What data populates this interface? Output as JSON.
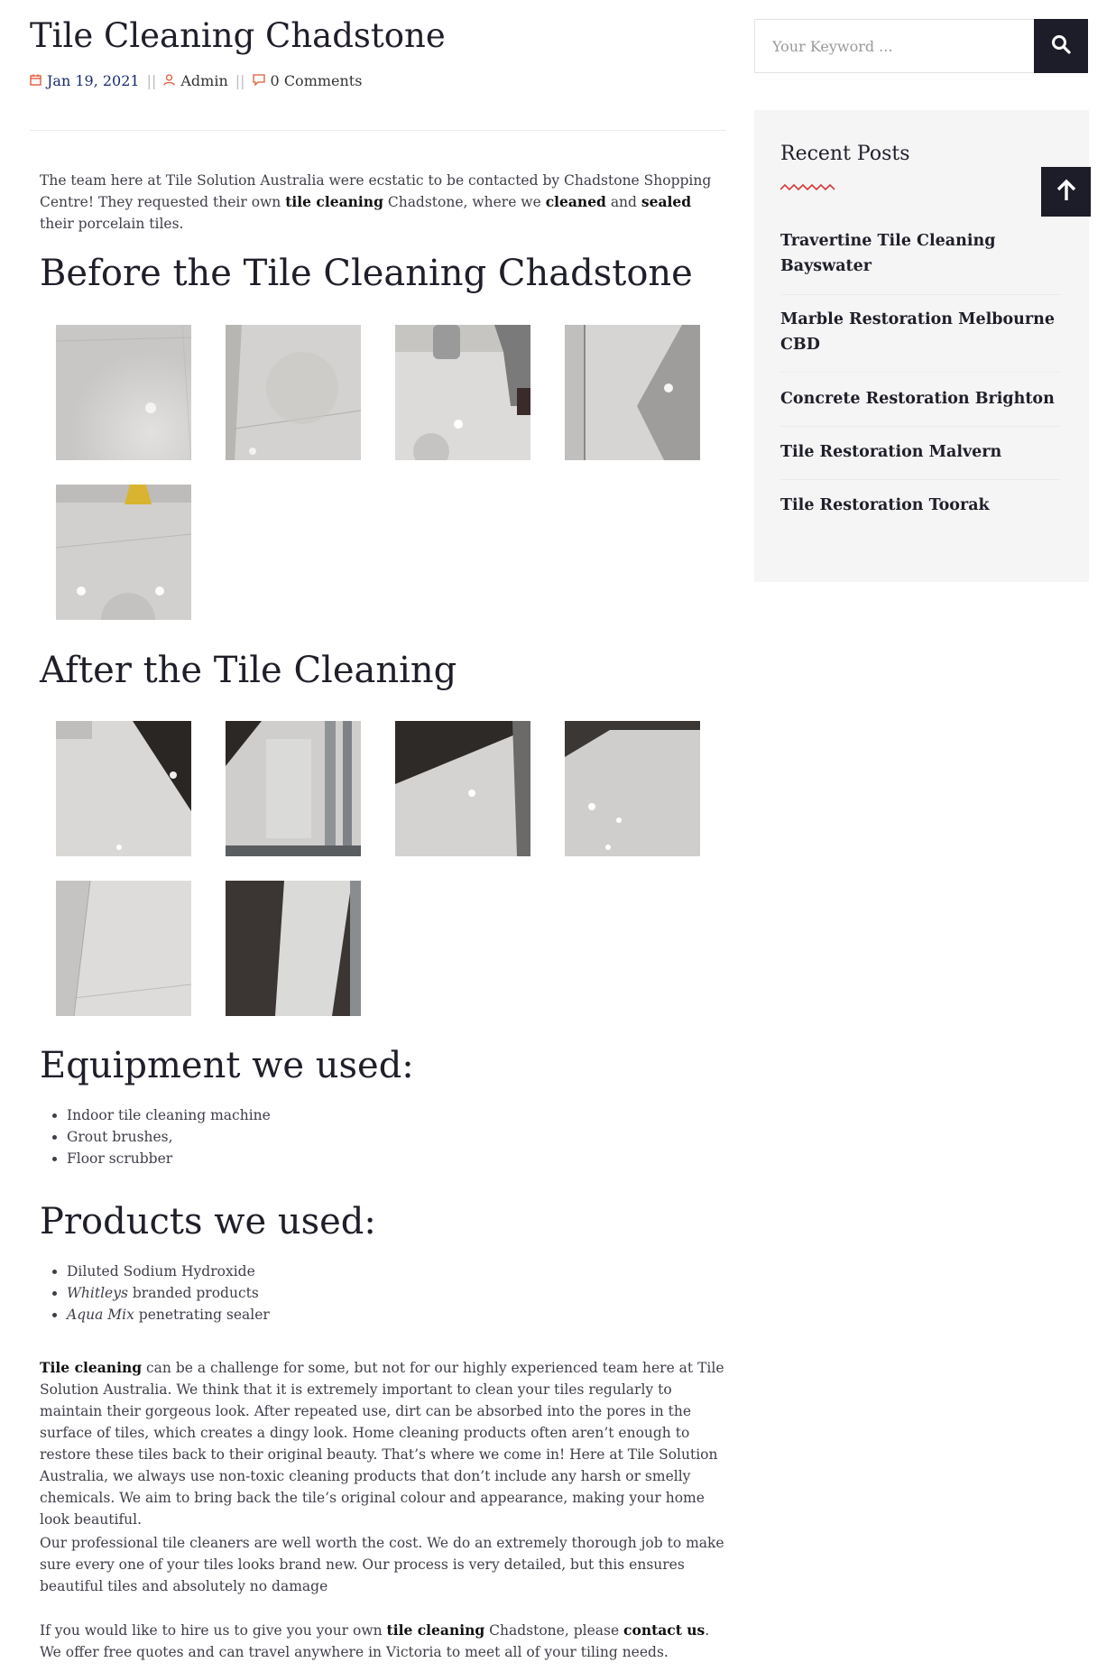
{
  "post": {
    "title": "Tile Cleaning Chadstone",
    "date": "Jan 19, 2021",
    "author": "Admin",
    "comments": "0 Comments"
  },
  "intro": {
    "t1": "The team here at Tile Solution Australia were ecstatic to be contacted by Chadstone Shopping Centre! They requested their own ",
    "b1": "tile cleaning",
    "t2": " Chadstone, where we ",
    "b2": "cleaned",
    "t3": " and ",
    "b3": "sealed",
    "t4": " their porcelain tiles."
  },
  "before_heading": "Before the Tile Cleaning Chadstone",
  "after_heading": "After the Tile Cleaning",
  "equipment": {
    "heading": "Equipment we used:",
    "items": [
      "Indoor tile cleaning machine",
      "Grout brushes,",
      "Floor scrubber"
    ]
  },
  "products": {
    "heading": "Products we used:",
    "item1": "Diluted Sodium Hydroxide",
    "item2_em": "Whitleys",
    "item2_rest": " branded products",
    "item3_em": "Aqua Mix",
    "item3_rest": " penetrating sealer"
  },
  "body": {
    "p1_b": "Tile cleaning",
    "p1_rest": " can be a challenge for some, but not for our highly experienced team here at Tile Solution Australia. We think that it is extremely important to clean your tiles regularly to maintain their gorgeous look. After repeated use, dirt can be absorbed into the pores in the surface of tiles, which creates a dingy look. Home cleaning products often aren’t enough to restore these tiles back to their original beauty. That’s where we come in! Here at Tile Solution Australia, we always use non-toxic cleaning products that don’t include any harsh or smelly chemicals. We aim to bring back the tile’s original colour and appearance, making your home look beautiful.",
    "p2": "Our professional tile cleaners are well worth the cost. We do an extremely thorough job to make sure every one of your tiles looks brand new. Our process is very detailed, but this ensures beautiful tiles and absolutely no damage",
    "p3_t1": "If you would like to hire us to give you your own ",
    "p3_b1": "tile cleaning",
    "p3_t2": " Chadstone, please ",
    "p3_b2": "contact us",
    "p3_t3": ". We offer free quotes and can travel anywhere in Victoria to meet all of your tiling needs."
  },
  "sidebar": {
    "search_placeholder": "Your Keyword ...",
    "recent_title": "Recent Posts",
    "recent_posts": [
      "Travertine Tile Cleaning Bayswater",
      "Marble Restoration Melbourne CBD",
      "Concrete Restoration Brighton",
      "Tile Restoration Malvern",
      "Tile Restoration Toorak"
    ]
  },
  "icons": {
    "calendar": "calendar-icon",
    "user": "user-icon",
    "comment": "comment-icon",
    "search": "search-icon",
    "arrow_up": "arrow-up-icon"
  },
  "colors": {
    "accent": "#e05a3a",
    "dark": "#1d1d29",
    "squiggle": "#d9383a"
  }
}
